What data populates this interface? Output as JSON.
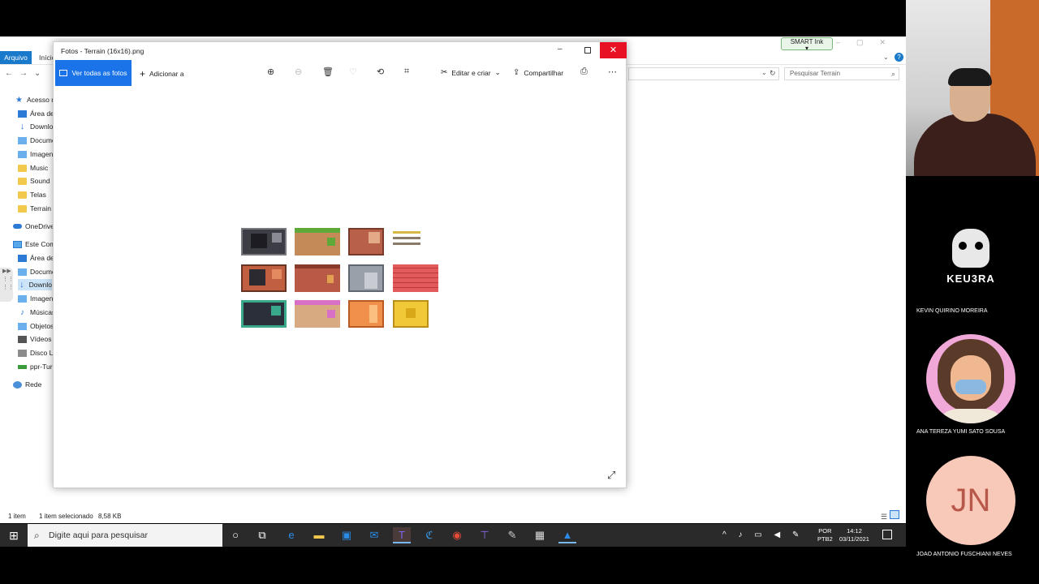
{
  "photos": {
    "title": "Fotos - Terrain (16x16).png",
    "toolbar": {
      "see_all": "Ver todas as fotos",
      "add_to": "Adicionar a",
      "edit_create": "Editar e criar",
      "share": "Compartilhar"
    }
  },
  "explorer": {
    "tab_file": "Arquivo",
    "tab_home": "Início",
    "search_placeholder": "Pesquisar Terrain",
    "smart_ink": "SMART Ink",
    "sidebar": [
      {
        "label": "Acesso rápido",
        "icon": "star-icon"
      },
      {
        "label": "Área de",
        "icon": "desktop-icon"
      },
      {
        "label": "Downlo",
        "icon": "download-icon"
      },
      {
        "label": "Docume",
        "icon": "documents-icon"
      },
      {
        "label": "Imagen",
        "icon": "pictures-icon"
      },
      {
        "label": "Music",
        "icon": "folder-icon"
      },
      {
        "label": "Sound",
        "icon": "folder-icon"
      },
      {
        "label": "Telas",
        "icon": "folder-icon"
      },
      {
        "label": "Terrain",
        "icon": "folder-icon"
      },
      {
        "label": "OneDrive",
        "icon": "cloud-icon"
      },
      {
        "label": "Este Com",
        "icon": "computer-icon"
      },
      {
        "label": "Área de",
        "icon": "desktop-icon"
      },
      {
        "label": "Docume",
        "icon": "documents-icon"
      },
      {
        "label": "Downlo",
        "icon": "download-icon"
      },
      {
        "label": "Imagen",
        "icon": "pictures-icon"
      },
      {
        "label": "Músicas",
        "icon": "music-icon"
      },
      {
        "label": "Objetos",
        "icon": "3d-objects-icon"
      },
      {
        "label": "Vídeos",
        "icon": "videos-icon"
      },
      {
        "label": "Disco Lo",
        "icon": "disk-icon"
      },
      {
        "label": "ppr-Tur",
        "icon": "network-drive-icon"
      },
      {
        "label": "Rede",
        "icon": "network-icon"
      }
    ],
    "status": {
      "items": "1 item",
      "selected": "1 item selecionado",
      "size": "8,58 KB"
    }
  },
  "taskbar": {
    "search_placeholder": "Digite aqui para pesquisar",
    "lang_line1": "POR",
    "lang_line2": "PTB2",
    "time": "14:12",
    "date": "03/11/2021"
  },
  "participants": [
    {
      "name": "KEVIN QUIRINO MOREIRA",
      "avatar_text": "KEU3RA"
    },
    {
      "name": "ANA TEREZA YUMI SATO SOUSA"
    },
    {
      "name": "JOAO ANTONIO FUSCHIANI NEVES",
      "initials": "JN"
    }
  ]
}
